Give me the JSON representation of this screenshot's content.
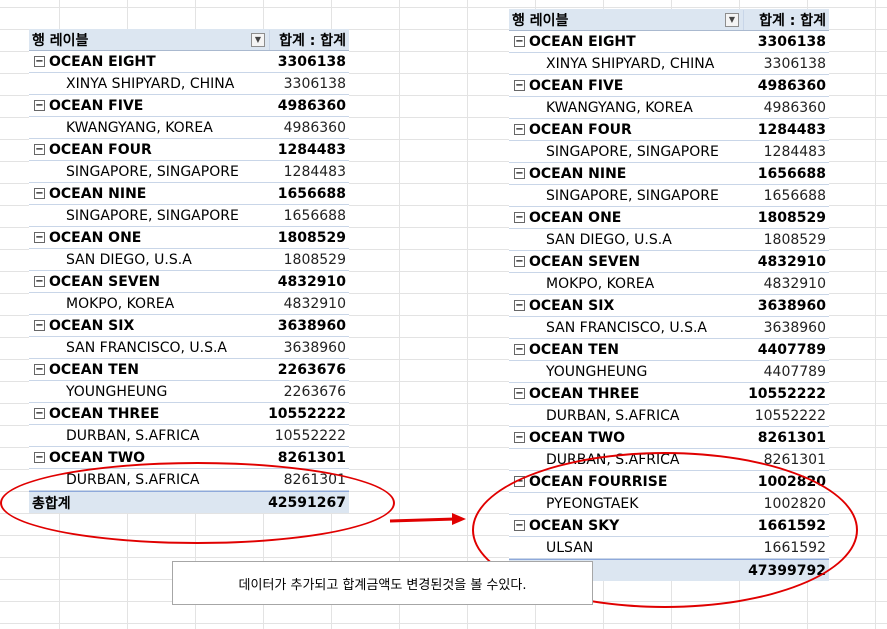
{
  "accent": "#e00000",
  "header_fill": "#dce6f1",
  "left_pivot": {
    "header_label": "행 레이블",
    "header_sum": "합계 : 합계",
    "groups": [
      {
        "name": "OCEAN EIGHT",
        "total": "3306138",
        "sub": "XINYA SHIPYARD, CHINA",
        "sub_val": "3306138"
      },
      {
        "name": "OCEAN FIVE",
        "total": "4986360",
        "sub": "KWANGYANG, KOREA",
        "sub_val": "4986360"
      },
      {
        "name": "OCEAN FOUR",
        "total": "1284483",
        "sub": "SINGAPORE, SINGAPORE",
        "sub_val": "1284483"
      },
      {
        "name": "OCEAN NINE",
        "total": "1656688",
        "sub": "SINGAPORE, SINGAPORE",
        "sub_val": "1656688"
      },
      {
        "name": "OCEAN ONE",
        "total": "1808529",
        "sub": "SAN DIEGO, U.S.A",
        "sub_val": "1808529"
      },
      {
        "name": "OCEAN SEVEN",
        "total": "4832910",
        "sub": "MOKPO, KOREA",
        "sub_val": "4832910"
      },
      {
        "name": "OCEAN SIX",
        "total": "3638960",
        "sub": "SAN FRANCISCO, U.S.A",
        "sub_val": "3638960"
      },
      {
        "name": "OCEAN TEN",
        "total": "2263676",
        "sub": "YOUNGHEUNG",
        "sub_val": "2263676"
      },
      {
        "name": "OCEAN THREE",
        "total": "10552222",
        "sub": "DURBAN, S.AFRICA",
        "sub_val": "10552222"
      },
      {
        "name": "OCEAN TWO",
        "total": "8261301",
        "sub": "DURBAN, S.AFRICA",
        "sub_val": "8261301"
      }
    ],
    "grand_label": "총합계",
    "grand_total": "42591267"
  },
  "right_pivot": {
    "header_label": "행 레이블",
    "header_sum": "합계 : 합계",
    "groups": [
      {
        "name": "OCEAN EIGHT",
        "total": "3306138",
        "sub": "XINYA SHIPYARD, CHINA",
        "sub_val": "3306138"
      },
      {
        "name": "OCEAN FIVE",
        "total": "4986360",
        "sub": "KWANGYANG, KOREA",
        "sub_val": "4986360"
      },
      {
        "name": "OCEAN FOUR",
        "total": "1284483",
        "sub": "SINGAPORE, SINGAPORE",
        "sub_val": "1284483"
      },
      {
        "name": "OCEAN NINE",
        "total": "1656688",
        "sub": "SINGAPORE, SINGAPORE",
        "sub_val": "1656688"
      },
      {
        "name": "OCEAN ONE",
        "total": "1808529",
        "sub": "SAN DIEGO, U.S.A",
        "sub_val": "1808529"
      },
      {
        "name": "OCEAN SEVEN",
        "total": "4832910",
        "sub": "MOKPO, KOREA",
        "sub_val": "4832910"
      },
      {
        "name": "OCEAN SIX",
        "total": "3638960",
        "sub": "SAN FRANCISCO, U.S.A",
        "sub_val": "3638960"
      },
      {
        "name": "OCEAN TEN",
        "total": "4407789",
        "sub": "YOUNGHEUNG",
        "sub_val": "4407789"
      },
      {
        "name": "OCEAN THREE",
        "total": "10552222",
        "sub": "DURBAN, S.AFRICA",
        "sub_val": "10552222"
      },
      {
        "name": "OCEAN TWO",
        "total": "8261301",
        "sub": "DURBAN, S.AFRICA",
        "sub_val": "8261301"
      },
      {
        "name": "OCEAN FOURRISE",
        "total": "1002820",
        "sub": "PYEONGTAEK",
        "sub_val": "1002820"
      },
      {
        "name": "OCEAN SKY",
        "total": "1661592",
        "sub": "ULSAN",
        "sub_val": "1661592"
      }
    ],
    "grand_total": "47399792"
  },
  "note_text": "데이터가 추가되고 합계금액도 변경된것을 볼 수있다.",
  "icons": {
    "collapse": "minus-box-icon",
    "dropdown": "filter-dropdown-icon",
    "arrow": "right-arrow-icon"
  }
}
